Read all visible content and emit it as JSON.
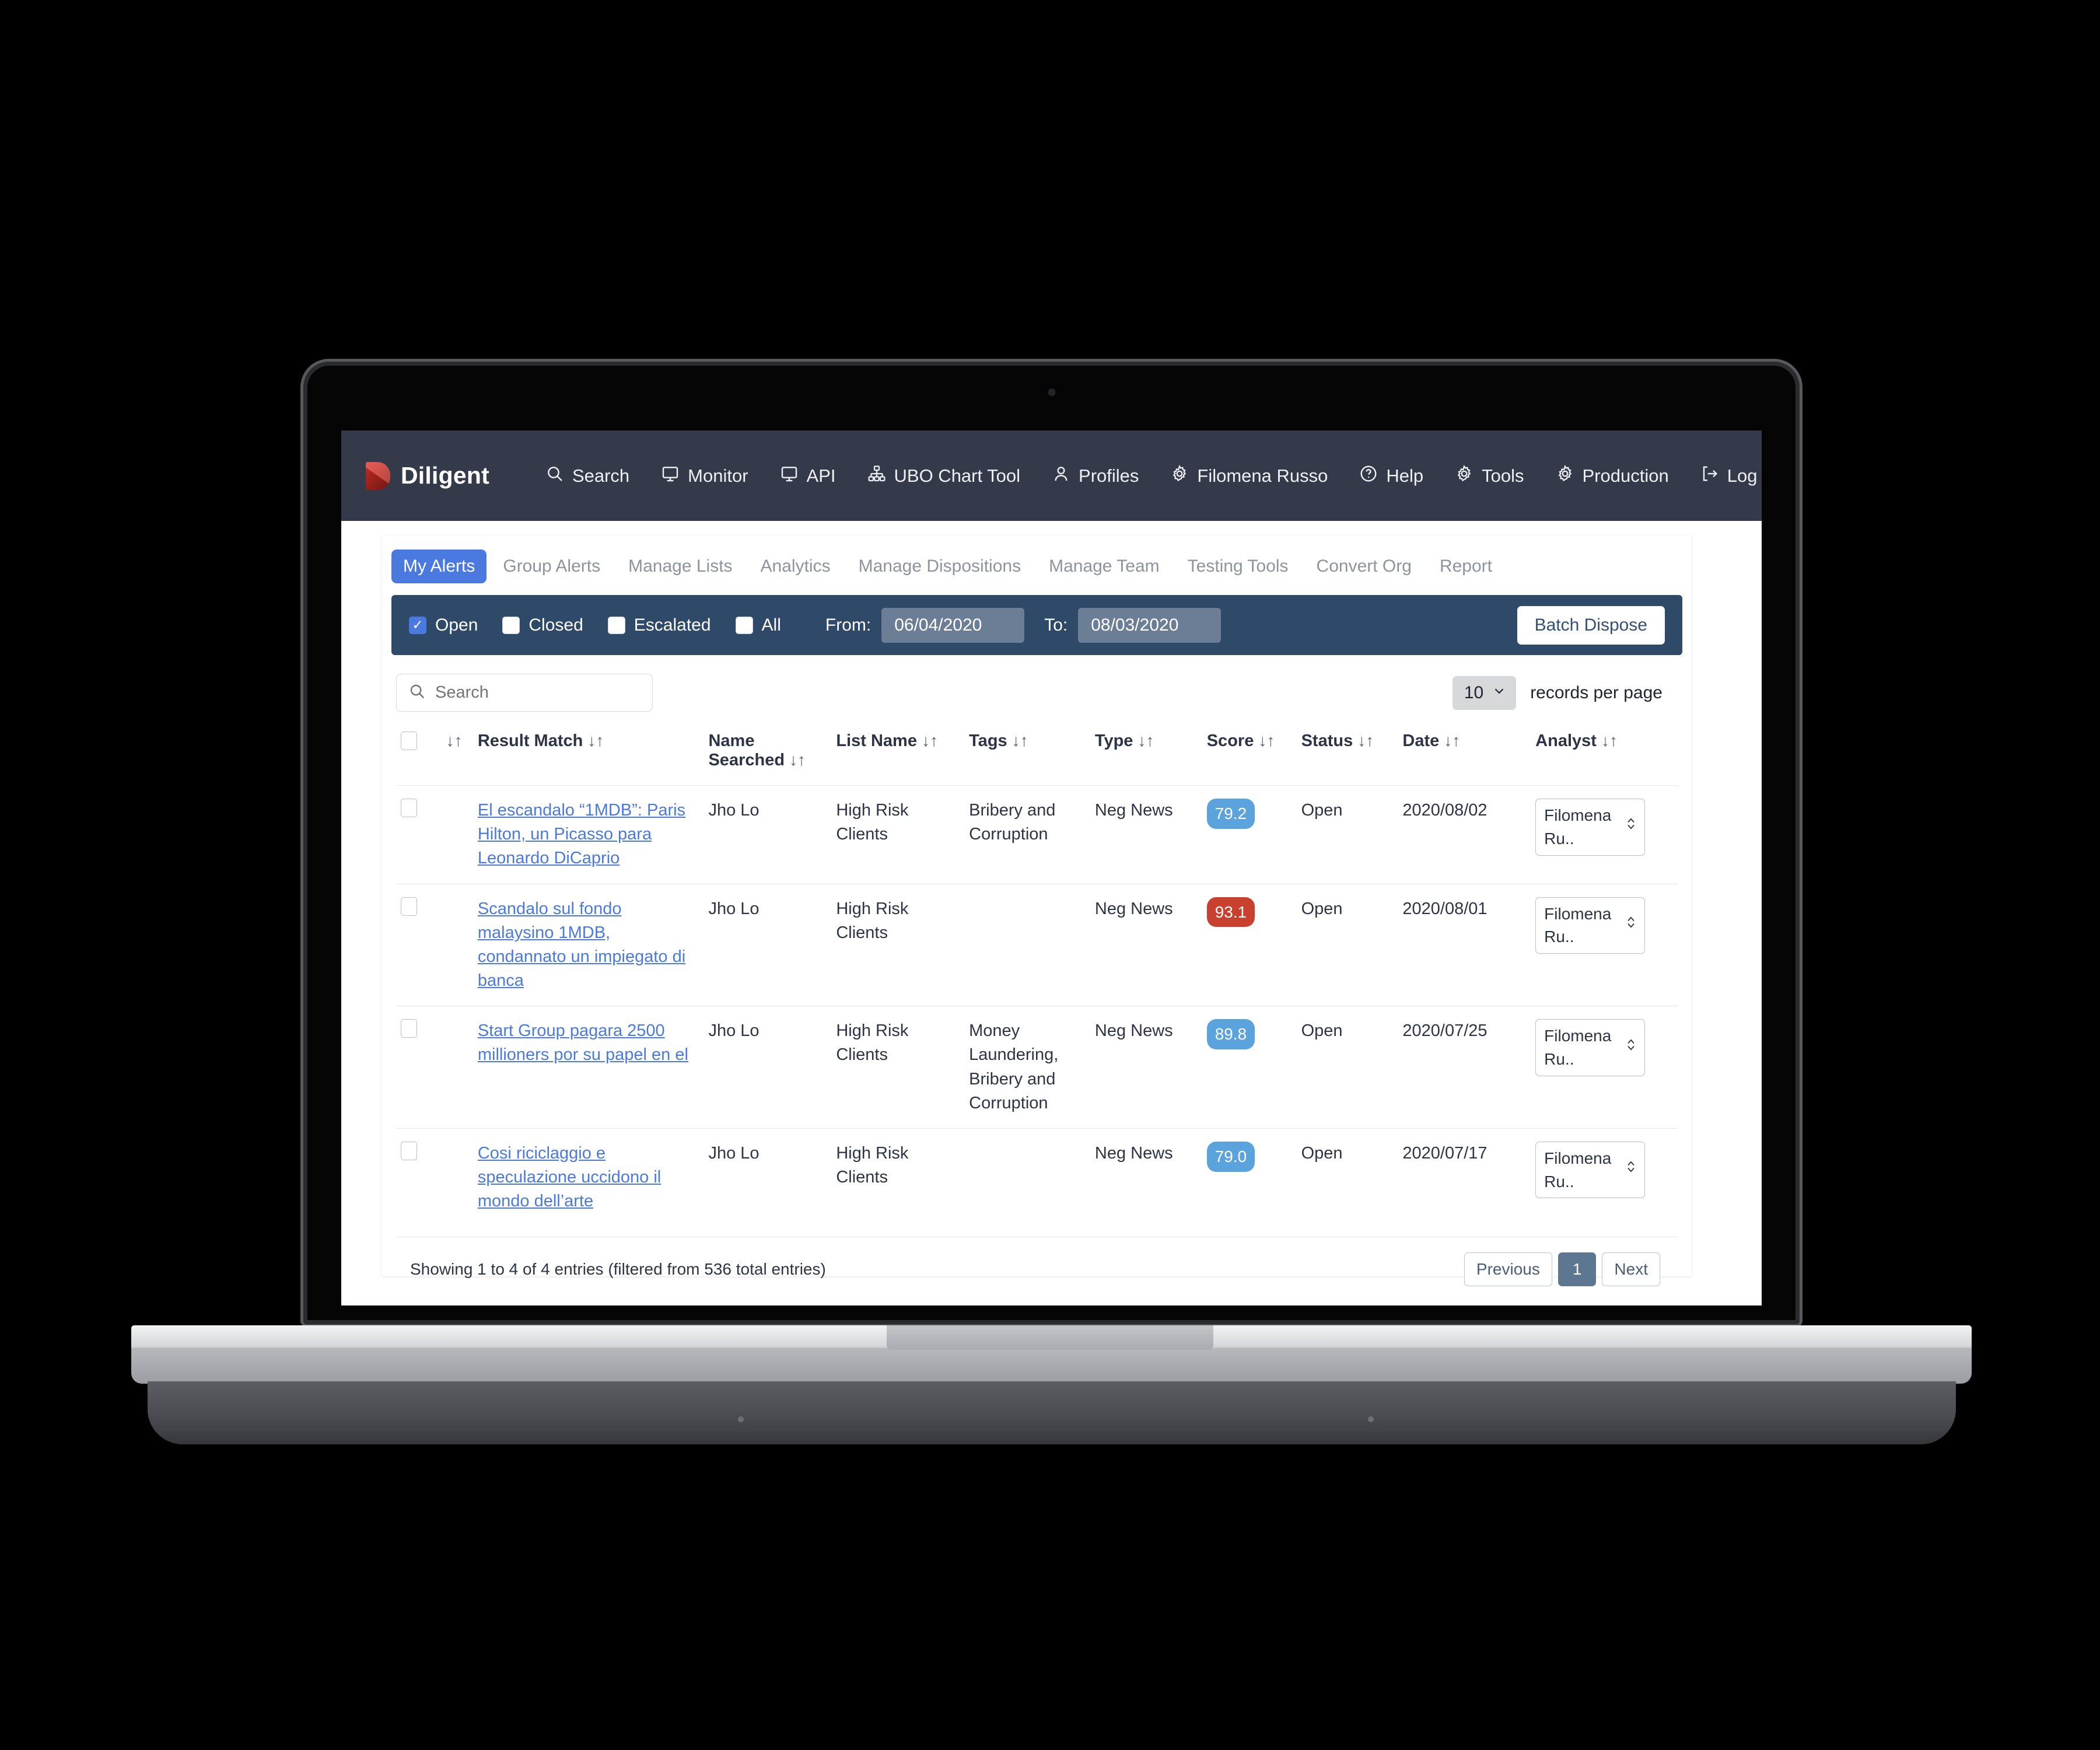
{
  "topnav": {
    "brand": "Diligent",
    "items": [
      {
        "label": "Search",
        "icon": "search-icon"
      },
      {
        "label": "Monitor",
        "icon": "monitor-icon"
      },
      {
        "label": "API",
        "icon": "monitor-icon"
      },
      {
        "label": "UBO Chart Tool",
        "icon": "org-chart-icon"
      },
      {
        "label": "Profiles",
        "icon": "person-icon"
      },
      {
        "label": "Filomena Russo",
        "icon": "gear-icon"
      },
      {
        "label": "Help",
        "icon": "help-icon"
      },
      {
        "label": "Tools",
        "icon": "gear-icon"
      },
      {
        "label": "Production",
        "icon": "gear-icon"
      },
      {
        "label": "Log Out",
        "icon": "logout-icon"
      }
    ]
  },
  "tabs": [
    {
      "label": "My Alerts",
      "active": true
    },
    {
      "label": "Group Alerts",
      "active": false
    },
    {
      "label": "Manage Lists",
      "active": false
    },
    {
      "label": "Analytics",
      "active": false
    },
    {
      "label": "Manage Dispositions",
      "active": false
    },
    {
      "label": "Manage Team",
      "active": false
    },
    {
      "label": "Testing Tools",
      "active": false
    },
    {
      "label": "Convert Org",
      "active": false
    },
    {
      "label": "Report",
      "active": false
    }
  ],
  "filterbar": {
    "checkboxes": [
      {
        "label": "Open",
        "checked": true
      },
      {
        "label": "Closed",
        "checked": false
      },
      {
        "label": "Escalated",
        "checked": false
      },
      {
        "label": "All",
        "checked": false
      }
    ],
    "from_label": "From:",
    "from_value": "06/04/2020",
    "to_label": "To:",
    "to_value": "08/03/2020",
    "batch_dispose_label": "Batch Dispose"
  },
  "toolbar": {
    "search_placeholder": "Search",
    "search_value": "",
    "records_per_page_value": "10",
    "records_per_page_label": "records per page"
  },
  "table": {
    "sort_glyph": "↓↑",
    "columns": [
      "",
      "",
      "Result Match",
      "Name Searched",
      "List Name",
      "Tags",
      "Type",
      "Score",
      "Status",
      "Date",
      "Analyst"
    ],
    "rows": [
      {
        "result_match": "El escandalo “1MDB”: Paris Hilton, un Picasso para Leonardo DiCaprio",
        "name_searched": "Jho Lo",
        "list_name": "High Risk Clients",
        "tags": "Bribery and Corruption",
        "type": "Neg News",
        "score": "79.2",
        "score_color": "#5ba3dd",
        "status": "Open",
        "date": "2020/08/02",
        "analyst": "Filomena Ru.."
      },
      {
        "result_match": "Scandalo sul fondo malaysino 1MDB, condannato un impiegato di banca",
        "name_searched": "Jho Lo",
        "list_name": "High Risk Clients",
        "tags": "",
        "type": "Neg News",
        "score": "93.1",
        "score_color": "#c8412f",
        "status": "Open",
        "date": "2020/08/01",
        "analyst": "Filomena Ru.."
      },
      {
        "result_match": "Start Group pagara 2500 millioners por su papel en el",
        "name_searched": "Jho Lo",
        "list_name": "High Risk Clients",
        "tags": "Money Laundering, Bribery and Corruption",
        "type": "Neg News",
        "score": "89.8",
        "score_color": "#5ba3dd",
        "status": "Open",
        "date": "2020/07/25",
        "analyst": "Filomena Ru.."
      },
      {
        "result_match": "Cosi riciclaggio e speculazione uccidono il mondo dell’arte",
        "name_searched": "Jho Lo",
        "list_name": "High Risk Clients",
        "tags": "",
        "type": "Neg News",
        "score": "79.0",
        "score_color": "#5ba3dd",
        "status": "Open",
        "date": "2020/07/17",
        "analyst": "Filomena Ru.."
      }
    ]
  },
  "footer": {
    "showing": "Showing 1 to 4 of 4 entries (filtered from 536 total entries)",
    "previous_label": "Previous",
    "page_label": "1",
    "next_label": "Next"
  },
  "colors": {
    "navbar": "#353a4b",
    "filterbar": "#2f4968",
    "accent": "#4a7ae0",
    "brand_red": "#c62a22"
  }
}
